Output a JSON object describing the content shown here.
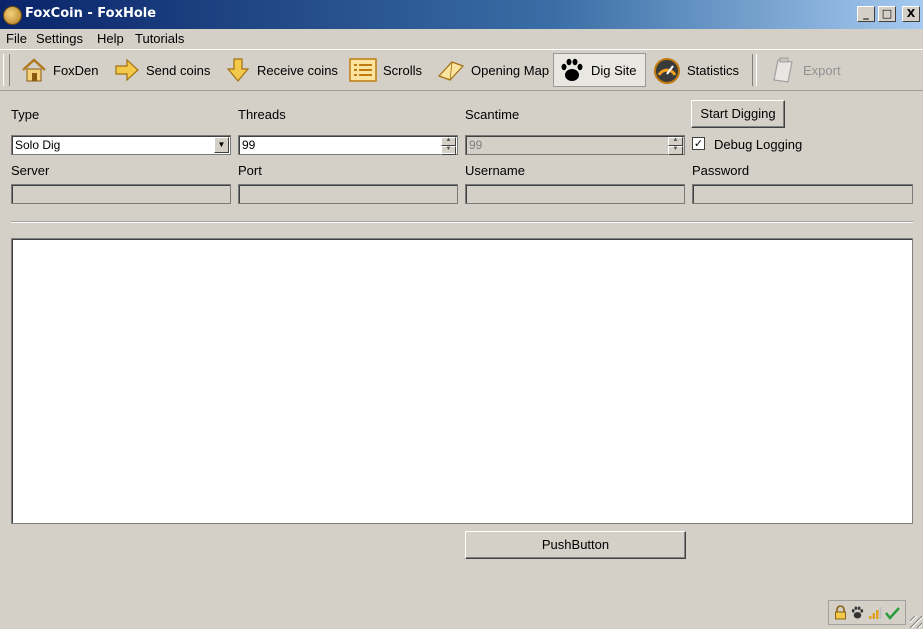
{
  "window": {
    "title": "FoxCoin - FoxHole",
    "controls": {
      "minimize": "_",
      "maximize": "□",
      "close": "X"
    }
  },
  "menu": {
    "items": [
      "File",
      "Settings",
      "Help",
      "Tutorials"
    ]
  },
  "toolbar": {
    "buttons": [
      {
        "label": "FoxDen",
        "icon": "house-icon"
      },
      {
        "label": "Send coins",
        "icon": "arrow-right-icon"
      },
      {
        "label": "Receive coins",
        "icon": "arrow-down-icon"
      },
      {
        "label": "Scrolls",
        "icon": "list-icon"
      },
      {
        "label": "Opening Map",
        "icon": "map-icon"
      },
      {
        "label": "Dig Site",
        "icon": "paw-icon",
        "active": true
      },
      {
        "label": "Statistics",
        "icon": "gauge-icon"
      },
      {
        "label": "Export",
        "icon": "clipboard-icon",
        "disabled": true
      }
    ]
  },
  "form": {
    "type_label": "Type",
    "type_value": "Solo Dig",
    "threads_label": "Threads",
    "threads_value": "99",
    "scantime_label": "Scantime",
    "scantime_value": "99",
    "start_button": "Start Digging",
    "debug_label": "Debug Logging",
    "debug_checked": true,
    "server_label": "Server",
    "server_value": "",
    "port_label": "Port",
    "port_value": "",
    "username_label": "Username",
    "username_value": "",
    "password_label": "Password",
    "password_value": ""
  },
  "log_text": "",
  "push_button": "PushButton",
  "status_icons": [
    "lock-icon",
    "paw-icon",
    "signal-bars-icon",
    "checkmark-icon"
  ],
  "colors": {
    "accent": "#0a246a",
    "checkmark": "#2a9d3a",
    "signal": "#e0a020"
  }
}
